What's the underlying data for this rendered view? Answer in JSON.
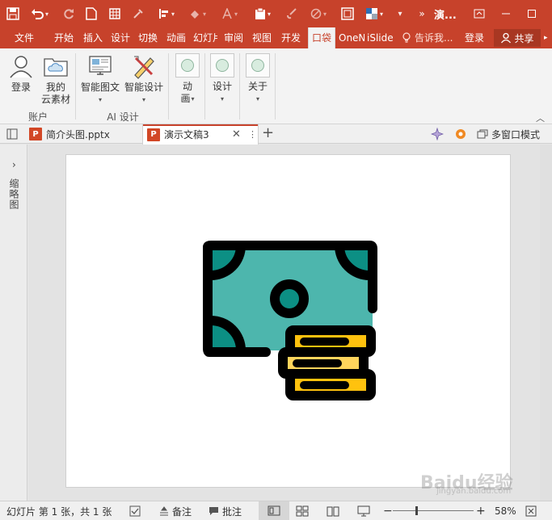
{
  "titlebar": {
    "title": "演...",
    "colors": {
      "accent": "#c7422b"
    }
  },
  "ribbon_tabs": [
    {
      "label": "文件"
    },
    {
      "label": "开始"
    },
    {
      "label": "插入"
    },
    {
      "label": "设计"
    },
    {
      "label": "切换"
    },
    {
      "label": "动画"
    },
    {
      "label": "幻灯片"
    },
    {
      "label": "审阅"
    },
    {
      "label": "视图"
    },
    {
      "label": "开发"
    },
    {
      "label": "口袋"
    },
    {
      "label": "OneN"
    },
    {
      "label": "iSlide"
    }
  ],
  "tell_me": "告诉我...",
  "login": "登录",
  "share": "共享",
  "ribbon": {
    "login_btn": "登录",
    "cloud_btn_line1": "我的",
    "cloud_btn_line2": "云素材",
    "group_account": "账户",
    "smart_graphic": "智能图文",
    "smart_design": "智能设计",
    "group_ai": "AI 设计",
    "anim_line1": "动",
    "anim_line2": "画",
    "design": "设计",
    "about": "关于"
  },
  "doc_tabs": [
    {
      "label": "简介头图.pptx",
      "active": false
    },
    {
      "label": "演示文稿3",
      "active": true
    }
  ],
  "multi_window": "多窗口模式",
  "thumbnails_label": "缩略图",
  "status": {
    "slide_info": "幻灯片 第 1 张，共 1 张",
    "notes": "备注",
    "comments": "批注",
    "zoom": "58%",
    "zoom_level": 0.58
  },
  "watermark": "Baidu经验",
  "watermark_sub": "jingyan.baidu.com",
  "icons": [
    "save-icon",
    "undo-icon",
    "redo-icon",
    "new-icon",
    "grid-icon",
    "eyedropper-icon",
    "align-icon",
    "fill-icon",
    "font-icon",
    "clipboard-icon",
    "brush-icon",
    "erase-icon",
    "fit-icon",
    "theme-icon",
    "more-icon",
    "money-coins-icon"
  ]
}
